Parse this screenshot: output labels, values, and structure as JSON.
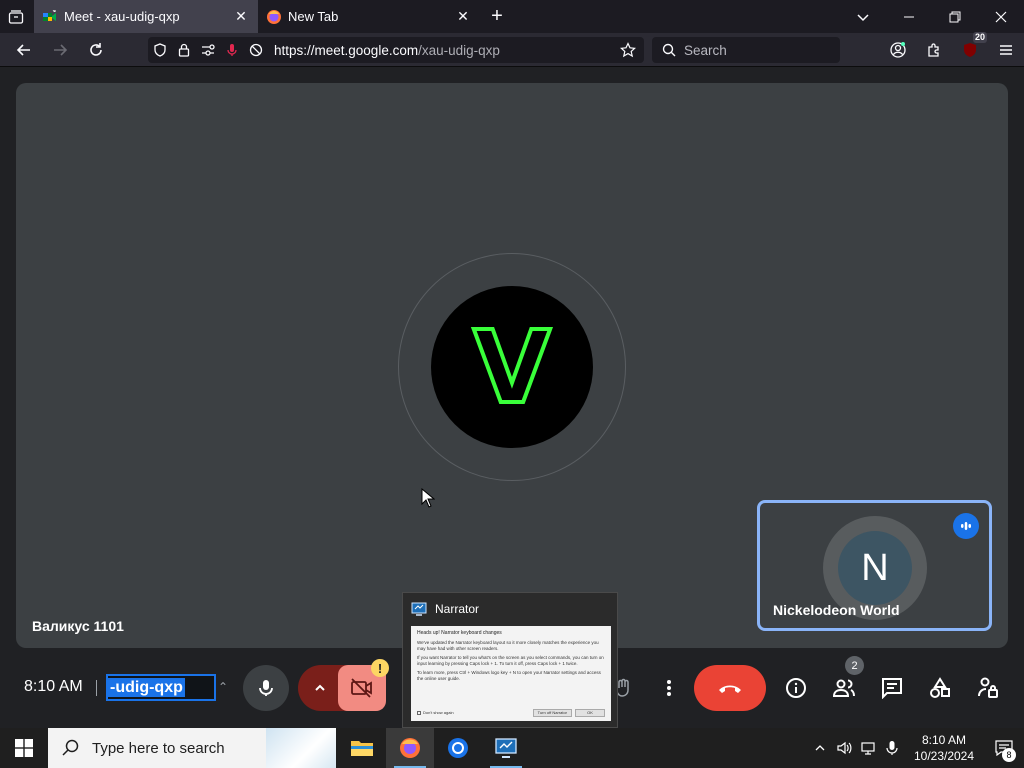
{
  "browser": {
    "tabs": [
      {
        "title": "Meet - xau-udig-qxp",
        "active": true,
        "favicon": "google-meet-icon"
      },
      {
        "title": "New Tab",
        "active": false,
        "favicon": "firefox-icon"
      }
    ],
    "url": {
      "host": "https://meet.google.com",
      "path": "/xau-udig-qxp"
    },
    "search_placeholder": "Search",
    "extensions_badge": "20"
  },
  "meet": {
    "main_participant": {
      "name": "Валикус 1101",
      "avatar_letter": "V"
    },
    "self_tile": {
      "name": "Nickelodeon World",
      "avatar_letter": "N"
    },
    "time": "8:10 AM",
    "meeting_code_selected": "-udig-qxp",
    "camera_warning": "!",
    "people_count": "2",
    "colors": {
      "accent": "#1a73e8",
      "leave": "#ea4335",
      "cam_off": "#f28b82",
      "tile_border": "#8ab4f8"
    }
  },
  "narrator": {
    "title": "Narrator",
    "heading": "Heads up! Narrator keyboard changes",
    "p1": "We've updated the Narrator keyboard layout so it more closely matches the experience you may have had with other screen readers.",
    "p2": "If you want Narrator to tell you what's on the screen as you select commands, you can turn on input learning by pressing Caps lock + 1. To turn it off, press Caps lock + 1 twice.",
    "p3": "To learn more, press Ctrl + Windows logo key + N to open your Narrator settings and access the online user guide.",
    "checkbox_label": "Don't show again",
    "btn_turn_off": "Turn off Narrator",
    "btn_ok": "OK"
  },
  "taskbar": {
    "search_placeholder": "Type here to search",
    "time": "8:10 AM",
    "date": "10/23/2024",
    "notification_count": "8"
  }
}
